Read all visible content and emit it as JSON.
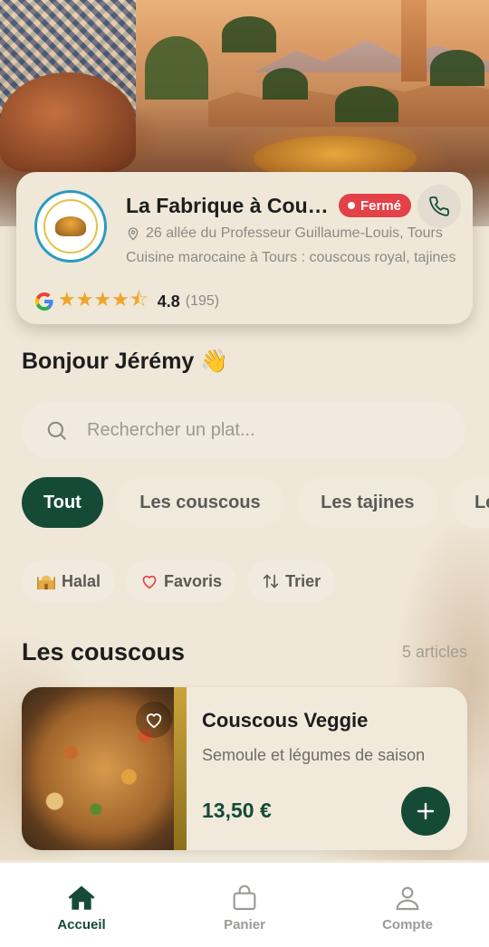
{
  "restaurant": {
    "name": "La Fabrique à Couscous",
    "status": "Fermé",
    "address": "26 allée du Professeur Guillaume-Louis, Tours",
    "description": "Cuisine marocaine à Tours : couscous royal, tajines",
    "rating": "4.8",
    "rating_count": "(195)",
    "stars_value": 4.5,
    "rating_source_icon": "google-icon"
  },
  "greeting": "Bonjour Jérémy 👋",
  "search": {
    "placeholder": "Rechercher un plat..."
  },
  "categories": [
    {
      "label": "Tout",
      "active": true
    },
    {
      "label": "Les couscous",
      "active": false
    },
    {
      "label": "Les tajines",
      "active": false
    },
    {
      "label": "Les",
      "active": false
    }
  ],
  "filters": [
    {
      "label": "Halal",
      "icon": "mosque-icon"
    },
    {
      "label": "Favoris",
      "icon": "heart-icon"
    },
    {
      "label": "Trier",
      "icon": "sort-icon"
    }
  ],
  "section": {
    "title": "Les couscous",
    "count": "5 articles"
  },
  "products": [
    {
      "name": "Couscous Veggie",
      "description": "Semoule et légumes de saison",
      "price": "13,50 €"
    }
  ],
  "nav": [
    {
      "label": "Accueil",
      "icon": "home-icon",
      "active": true
    },
    {
      "label": "Panier",
      "icon": "bag-icon",
      "active": false
    },
    {
      "label": "Compte",
      "icon": "user-icon",
      "active": false
    }
  ],
  "colors": {
    "brand_green": "#154a37",
    "closed_red": "#e34047",
    "star_orange": "#f0a52a",
    "background": "#efe7d7"
  }
}
